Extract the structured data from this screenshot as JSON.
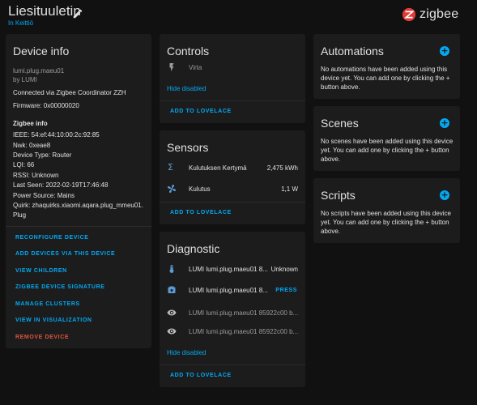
{
  "header": {
    "title": "Liesituuletin",
    "area": "In Keittiö",
    "logo_text": "zigbee"
  },
  "device_info": {
    "title": "Device info",
    "model": "lumi.plug.maeu01",
    "manufacturer": "by LUMI",
    "connected": "Connected via Zigbee Coordinator ZZH",
    "firmware": "Firmware: 0x00000020",
    "zigbee_info_title": "Zigbee info",
    "ieee": "IEEE: 54:ef:44:10:00:2c:92:85",
    "nwk": "Nwk: 0xeae8",
    "device_type": "Device Type: Router",
    "lqi": "LQI: 66",
    "rssi": "RSSI: Unknown",
    "last_seen": "Last Seen: 2022-02-19T17:46:48",
    "power_source": "Power Source: Mains",
    "quirk_line1": "Quirk: zhaquirks.xiaomi.aqara.plug_mmeu01.",
    "quirk_line2": "Plug",
    "actions": [
      "RECONFIGURE DEVICE",
      "ADD DEVICES VIA THIS DEVICE",
      "VIEW CHILDREN",
      "ZIGBEE DEVICE SIGNATURE",
      "MANAGE CLUSTERS",
      "VIEW IN VISUALIZATION",
      "REMOVE DEVICE"
    ]
  },
  "controls": {
    "title": "Controls",
    "entity_name": "Virta",
    "hide_disabled": "Hide disabled",
    "add_to_lovelace": "ADD TO LOVELACE"
  },
  "sensors": {
    "title": "Sensors",
    "rows": [
      {
        "name": "Kulutuksen Kertymä",
        "value": "2,475 kWh",
        "icon": "sigma-icon"
      },
      {
        "name": "Kulutus",
        "value": "1,1 W",
        "icon": "fan-icon"
      }
    ],
    "add_to_lovelace": "ADD TO LOVELACE"
  },
  "diagnostic": {
    "title": "Diagnostic",
    "rows": [
      {
        "name": "LUMI lumi.plug.maeu01 8...",
        "value": "Unknown",
        "icon": "thermometer-icon"
      },
      {
        "name": "LUMI lumi.plug.maeu01 8...",
        "value": "PRESS",
        "icon": "button-icon"
      },
      {
        "name": "LUMI lumi.plug.maeu01 85922c00 b...",
        "value": "",
        "icon": "eye-icon"
      },
      {
        "name": "LUMI lumi.plug.maeu01 85922c00 b...",
        "value": "",
        "icon": "eye-icon"
      }
    ],
    "hide_disabled": "Hide disabled",
    "add_to_lovelace": "ADD TO LOVELACE"
  },
  "automations": {
    "title": "Automations",
    "desc": "No automations have been added using this device yet. You can add one by clicking the + button above."
  },
  "scenes": {
    "title": "Scenes",
    "desc": "No scenes have been added using this device yet. You can add one by clicking the + button above."
  },
  "scripts": {
    "title": "Scripts",
    "desc": "No scripts have been added using this device yet. You can add one by clicking the + button above."
  },
  "colors": {
    "accent": "#03a9f4",
    "danger": "#e0533f",
    "background": "#111111",
    "card": "#1c1c1c"
  }
}
